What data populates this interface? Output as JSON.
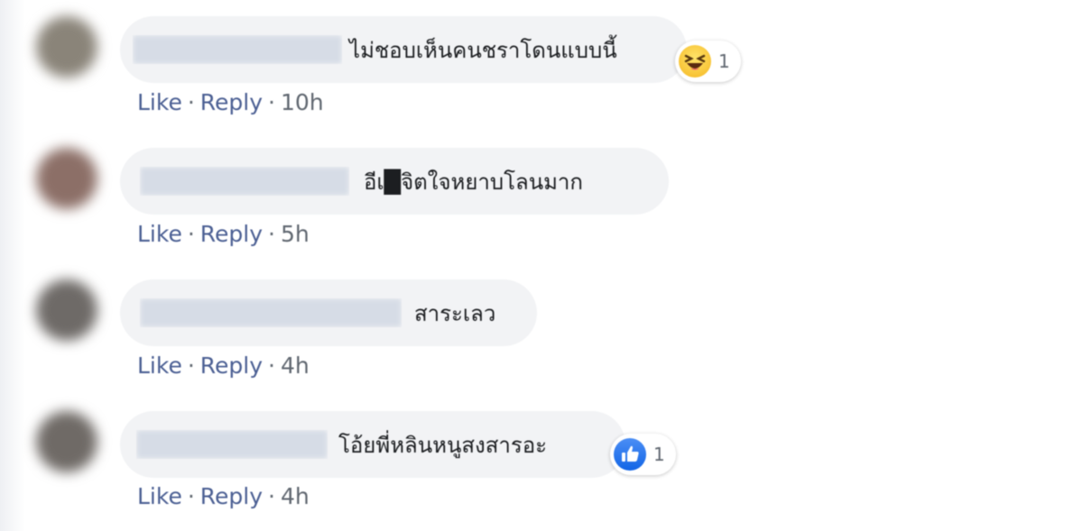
{
  "colors": {
    "bubble_bg": "#f2f3f5",
    "action_link": "#4b5f93",
    "meta_text": "#606770",
    "like_blue": "#1877f2",
    "haha_yellow": "#f7c33b"
  },
  "comments": [
    {
      "author": "████████████",
      "text": "ไม่ชอบเห็นคนชราโดนแบบนี้",
      "reaction_icon": "haha-emoji-icon",
      "reaction_count": "1",
      "like_label": "Like",
      "reply_label": "Reply",
      "separator": "·",
      "time": "10h"
    },
    {
      "author": "████████████",
      "text": "อีเ█จิตใจหยาบโลนมาก",
      "like_label": "Like",
      "reply_label": "Reply",
      "separator": "·",
      "time": "5h"
    },
    {
      "author": "██████████████",
      "text": "สาระเลว",
      "like_label": "Like",
      "reply_label": "Reply",
      "separator": "·",
      "time": "4h"
    },
    {
      "author": "████████████",
      "text": "โอ้ยพี่หลินหนูสงสารอะ",
      "reaction_icon": "like-thumb-icon",
      "reaction_count": "1",
      "like_label": "Like",
      "reply_label": "Reply",
      "separator": "·",
      "time": "4h"
    }
  ]
}
